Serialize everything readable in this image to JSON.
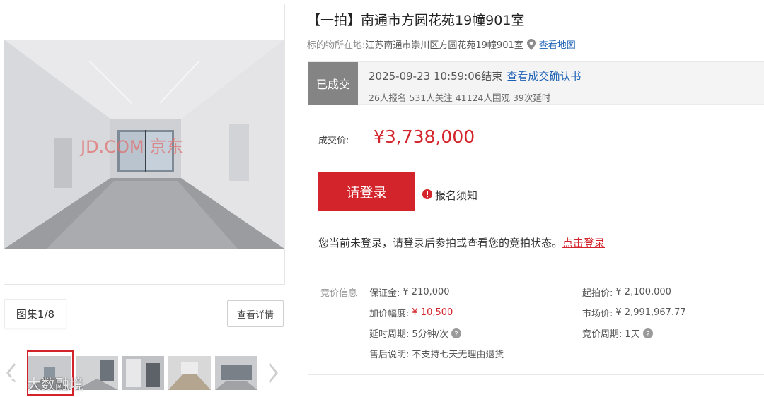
{
  "gallery": {
    "counter": "图集1/8",
    "detail_label": "查看详情",
    "watermark_text": "大数融境",
    "photo_watermark": "JD.COM 京东"
  },
  "item": {
    "title": "【一拍】南通市方圆花苑19幢901室",
    "location_label": "标的物所在地:",
    "location_value": "江苏南通市崇川区方圆花苑19幢901室",
    "map_link": "查看地图"
  },
  "status": {
    "badge": "已成交",
    "end_time": "2025-09-23 10:59:06结束",
    "confirm_link": "查看成交确认书",
    "stats": "26人报名  531人关注  41124人围观  39次延时"
  },
  "price": {
    "label": "成交价:",
    "value": "¥3,738,000"
  },
  "actions": {
    "login_button": "请登录",
    "notice": "报名须知",
    "login_tip": "您当前未登录，请登录后参拍或查看您的竞拍状态。",
    "login_link": "点击登录"
  },
  "bid_info": {
    "header": "竞价信息",
    "deposit_label": "保证金:",
    "deposit_value": "¥ 210,000",
    "increment_label": "加价幅度:",
    "increment_value": "¥ 10,500",
    "delay_label": "延时周期:",
    "delay_value": "5分钟/次",
    "aftersale_label": "售后说明:",
    "aftersale_value": "不支持七天无理由退货",
    "start_label": "起拍价:",
    "start_value": "¥ 2,100,000",
    "market_label": "市场价:",
    "market_value": "¥ 2,991,967.77",
    "cycle_label": "竞价周期:",
    "cycle_value": "1天"
  },
  "colors": {
    "accent_red": "#d4242b",
    "link_blue": "#1a5fb4",
    "badge_gray": "#848484"
  },
  "icons": [
    "location-pin-icon",
    "help-icon",
    "alert-icon",
    "chevron-left-icon",
    "chevron-right-icon",
    "weibo-icon"
  ]
}
